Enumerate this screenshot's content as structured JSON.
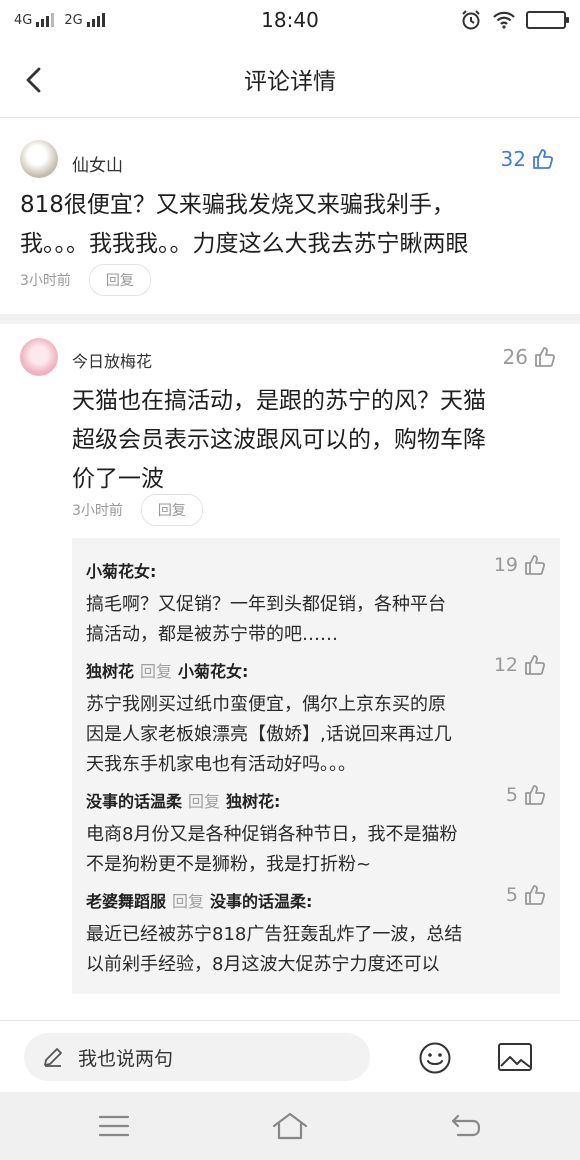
{
  "status_bar": {
    "signal_left": "4G",
    "signal_right": "2G",
    "time": "18:40"
  },
  "header": {
    "title": "评论详情",
    "back_icon": "back-arrow-icon"
  },
  "comments": [
    {
      "author": "仙女山",
      "likes": "32",
      "liked": true,
      "text_lines": [
        "818很便宜？又来骗我发烧又来骗我剁手，",
        "我。。。我我我。。力度这么大我去苏宁瞅两眼"
      ],
      "time": "3小时前",
      "reply_label": "回复"
    },
    {
      "author": "今日放梅花",
      "likes": "26",
      "liked": false,
      "text_lines": [
        "天猫也在搞活动，是跟的苏宁的风？天猫",
        "超级会员表示这波跟风可以的，购物车降",
        "价了一波"
      ],
      "time": "3小时前",
      "reply_label": "回复"
    }
  ],
  "replies": [
    {
      "author": "小菊花女:",
      "reply_word": "",
      "target": "",
      "likes": "19",
      "text_lines": [
        "搞毛啊？又促销？一年到头都促销，各种平台",
        "搞活动，都是被苏宁带的吧……"
      ]
    },
    {
      "author": "独树花",
      "reply_word": "回复",
      "target": "小菊花女:",
      "likes": "12",
      "text_lines": [
        "苏宁我刚买过纸巾蛮便宜，偶尔上京东买的原",
        "因是人家老板娘漂亮【傲娇】,话说回来再过几",
        "天我东手机家电也有活动好吗。。。"
      ]
    },
    {
      "author": "没事的话温柔",
      "reply_word": "回复",
      "target": "独树花:",
      "likes": "5",
      "text_lines": [
        "电商8月份又是各种促销各种节日，我不是猫粉",
        "不是狗粉更不是狮粉，我是打折粉~"
      ]
    },
    {
      "author": "老婆舞蹈服",
      "reply_word": "回复",
      "target": "没事的话温柔:",
      "likes": "5",
      "text_lines": [
        "最近已经被苏宁818广告狂轰乱炸了一波，总结",
        "以前剁手经验，8月这波大促苏宁力度还可以"
      ]
    }
  ],
  "input_bar": {
    "placeholder": "我也说两句",
    "icons": [
      "pencil-icon",
      "emoji-icon",
      "image-icon"
    ]
  },
  "nav_bar": {
    "icons": [
      "menu-icon",
      "home-icon",
      "back-icon"
    ]
  },
  "colors": {
    "accent_blue": "#3f7fd6",
    "muted": "#999999",
    "reply_bg": "#f4f4f4"
  }
}
